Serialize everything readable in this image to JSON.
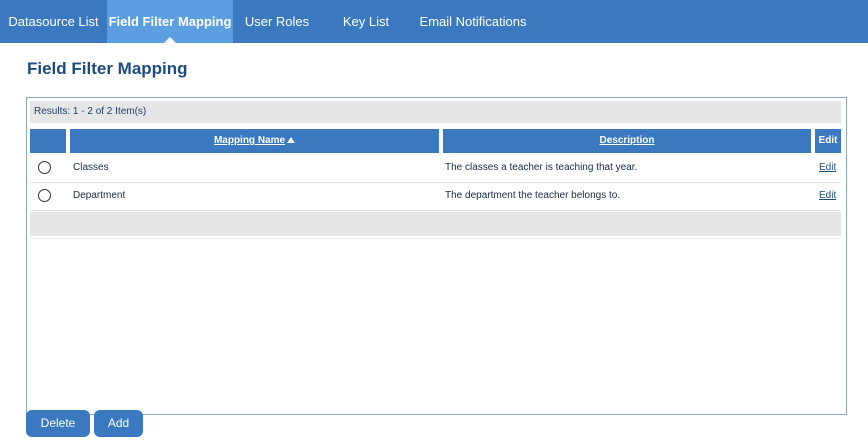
{
  "nav": {
    "tabs": [
      {
        "label": "Datasource List"
      },
      {
        "label": "Field Filter Mapping"
      },
      {
        "label": "User Roles"
      },
      {
        "label": "Key List"
      },
      {
        "label": "Email Notifications"
      }
    ]
  },
  "page": {
    "title": "Field Filter Mapping"
  },
  "grid": {
    "results_text": "Results: 1 - 2 of 2 Item(s)",
    "columns": {
      "mapping_name": "Mapping Name",
      "description": "Description",
      "edit": "Edit"
    },
    "rows": [
      {
        "name": "Classes",
        "description": "The classes a teacher is teaching that year.",
        "edit": "Edit"
      },
      {
        "name": "Department",
        "description": "The department the teacher belongs to.",
        "edit": "Edit"
      }
    ]
  },
  "buttons": {
    "delete": "Delete",
    "add": "Add"
  },
  "colors": {
    "nav_bg": "#3a79c0",
    "active_tab": "#5b9fe0",
    "title": "#1e4c80",
    "header_bg": "#3a79c0"
  }
}
